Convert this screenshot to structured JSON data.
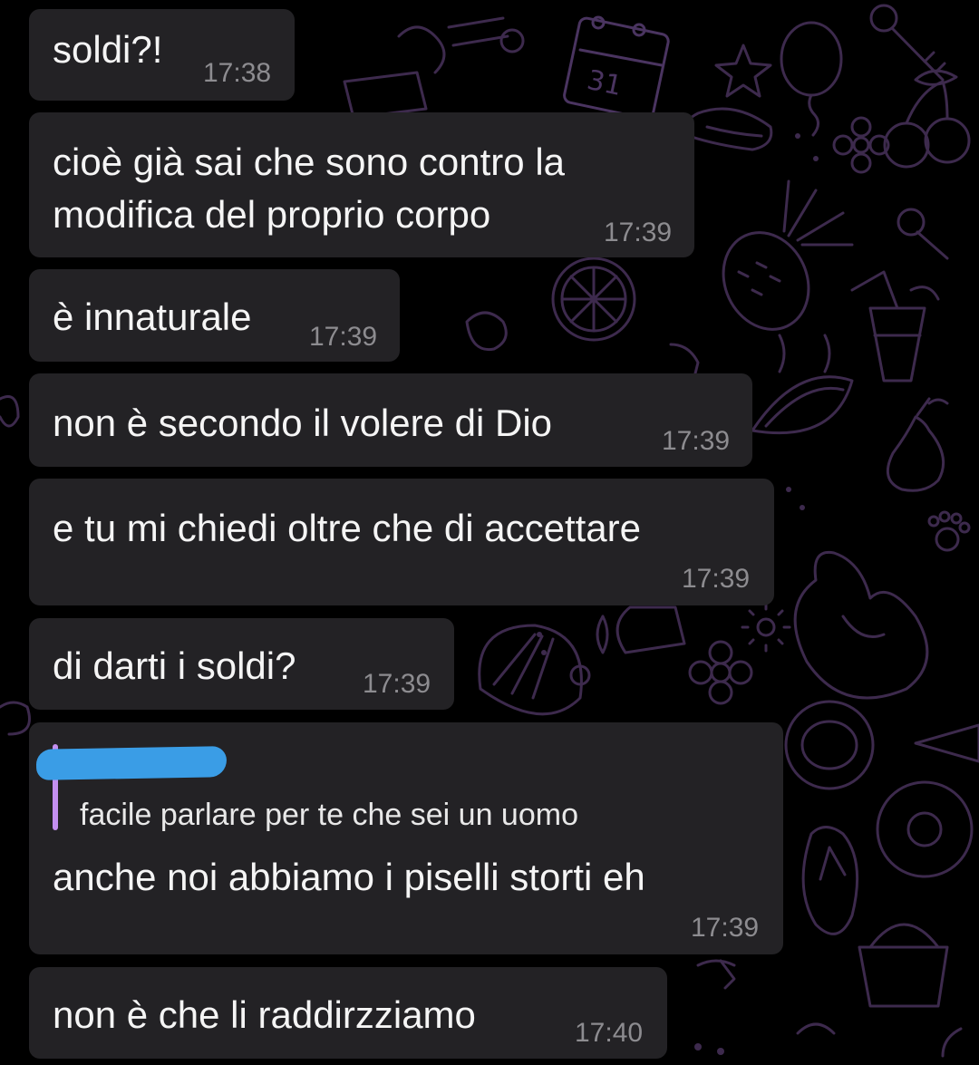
{
  "wallpaper": {
    "icons": [
      "calendar-icon",
      "starfish-icon",
      "balloon-icon",
      "key-icon",
      "cherries-icon",
      "hotdog-icon",
      "flower-icon",
      "pineapple-icon",
      "lemon-icon",
      "cocktail-icon",
      "watermelon-icon",
      "pear-icon",
      "duck-float-icon",
      "paw-icon",
      "sun-icon",
      "shell-icon",
      "coconut-icon",
      "donut-icon",
      "flip-flop-icon",
      "bucket-icon",
      "ice-cream-icon"
    ],
    "calendar_day": "31"
  },
  "colors": {
    "bubble": "#232225",
    "reply_bar": "#c48ff0",
    "redaction": "#3a9de6",
    "time": "#8d8c90"
  },
  "messages": [
    {
      "text": "soldi?!",
      "time": "17:38"
    },
    {
      "text": "cioè già sai che sono contro la\nmodifica del proprio corpo",
      "time": "17:39"
    },
    {
      "text": "è innaturale",
      "time": "17:39"
    },
    {
      "text": "non è secondo il volere di Dio",
      "time": "17:39"
    },
    {
      "text": "e tu mi chiedi oltre che di accettare",
      "time": "17:39"
    },
    {
      "text": "di darti i soldi?",
      "time": "17:39"
    },
    {
      "reply": {
        "sender": "",
        "text": "facile parlare per te che sei un uomo"
      },
      "text": "anche noi abbiamo i piselli storti eh",
      "time": "17:39"
    },
    {
      "text": "non è che li raddirzziamo",
      "time": "17:40"
    }
  ]
}
